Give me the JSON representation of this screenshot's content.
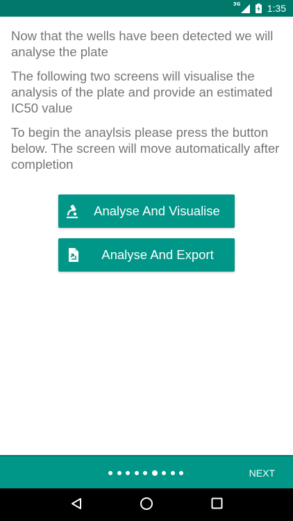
{
  "status_bar": {
    "network": "3G",
    "time": "1:35"
  },
  "content": {
    "paragraphs": [
      "Now that the wells have been detected we will analyse the plate",
      "The following two screens will visualise the analysis of the plate and provide an estimated IC50 value",
      "To begin the anaylsis please press the button below. The screen will move automatically after completion"
    ]
  },
  "buttons": {
    "visualise": {
      "label": "Analyse And Visualise",
      "icon": "microscope-icon"
    },
    "export": {
      "label": "Analyse And Export",
      "icon": "file-export-icon"
    }
  },
  "pager": {
    "total_pages": 9,
    "current_page": 6,
    "next_label": "NEXT"
  },
  "colors": {
    "status_bar": "#00796b",
    "accent": "#009688",
    "text": "#757575"
  }
}
